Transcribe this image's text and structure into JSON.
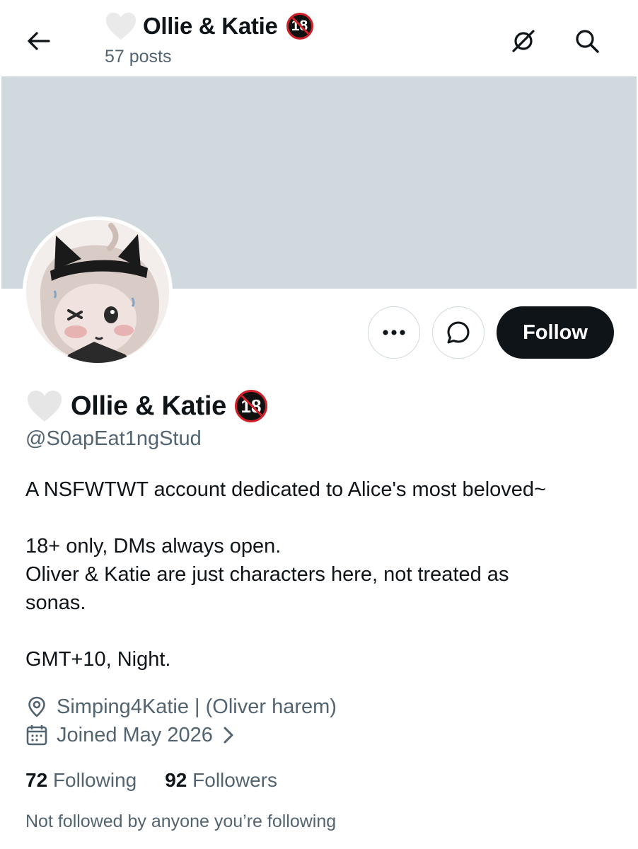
{
  "header": {
    "title": "Ollie & Katie",
    "badge": "18",
    "posts": "57 posts"
  },
  "profile": {
    "name": "Ollie & Katie",
    "badge": "18",
    "handle": "@S0apEat1ngStud",
    "follow_label": "Follow",
    "bio_lines": [
      "A NSFWTWT account dedicated to Alice's most beloved~",
      "",
      "18+ only, DMs always open.",
      "Oliver & Katie are just characters here, not treated as",
      "sonas.",
      "",
      "GMT+10, Night."
    ],
    "location": "Simping4Katie | (Oliver harem)",
    "joined": "Joined May 2026",
    "following_count": "72",
    "following_label": "Following",
    "followers_count": "92",
    "followers_label": "Followers",
    "followed_by_note": "Not followed by anyone you’re following"
  },
  "icons": {
    "back": "arrow-left-icon",
    "grok": "grok-icon",
    "search": "search-icon",
    "more": "more-icon",
    "message": "message-icon",
    "heart": "heart-icon",
    "location": "location-pin-icon",
    "calendar": "calendar-icon",
    "chevron": "chevron-right-icon"
  },
  "colors": {
    "banner": "#cfd9de",
    "follow_button": "#0f1419",
    "secondary_text": "#536471",
    "badge_ring": "#d0202a"
  }
}
